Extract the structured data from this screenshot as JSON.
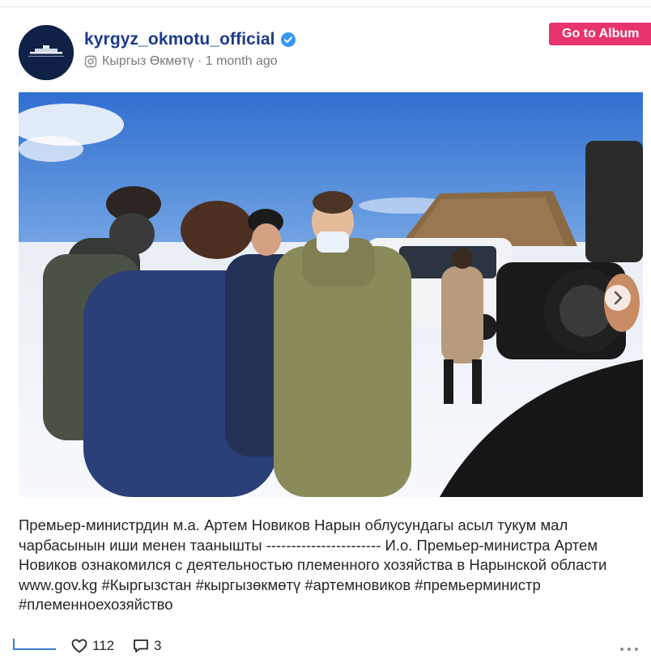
{
  "post": {
    "username": "kyrgyz_okmotu_official",
    "source_name": "Кыргыз Өкмөтү",
    "separator": " · ",
    "time_ago": "1 month ago",
    "go_to_album_label": "Go to Album",
    "caption": "Премьер-министрдин м.а. Артем Новиков Нарын облусундагы асыл тукум мал чарбасынын иши менен таанышты ----------------------- И.о. Премьер-министра Артем Новиков ознакомился с деятельностью племенного хозяйства в Нарынской области www.gov.kg #Кыргызстан #кыргызөкмөтү #артемновиков #премьерминистр #племенноехозяйство",
    "likes_count": "112",
    "comments_count": "3"
  },
  "icons": {
    "verified": "verified-badge-icon",
    "source": "instagram-icon",
    "likes": "heart-icon",
    "comments": "comment-icon",
    "more": "more-dots-icon",
    "next": "chevron-right-icon"
  },
  "colors": {
    "username": "#1f3a8f",
    "album_button": "#e8336d",
    "verified": "#3897f0"
  }
}
